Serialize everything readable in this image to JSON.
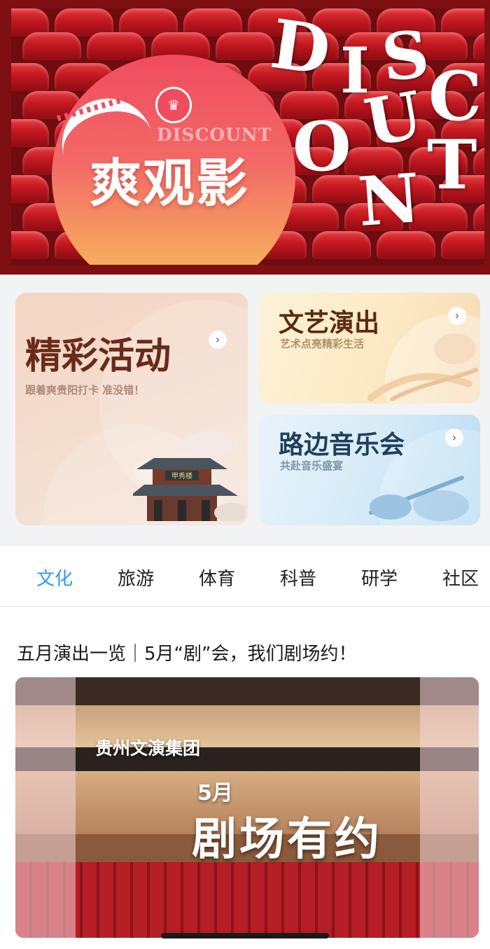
{
  "banner": {
    "title": "爽观影",
    "subtitle_en": "DISCOUNT",
    "big_letters": [
      "D",
      "I",
      "S",
      "C",
      "O",
      "U",
      "N",
      "T"
    ],
    "logo_icon": "theater-logo-icon",
    "colors": {
      "frame": "#7e1014",
      "seat": "#c2181f",
      "sun_top": "#f04c5e",
      "sun_bottom": "#f8c862"
    }
  },
  "cards": {
    "activities": {
      "title": "精彩活动",
      "subtitle": "跟着爽贵阳打卡  准没错！",
      "sign": "甲秀楼"
    },
    "performances": {
      "title": "文艺演出",
      "subtitle": "艺术点亮精彩生活"
    },
    "street_music": {
      "title": "路边音乐会",
      "subtitle": "共赴音乐盛宴"
    }
  },
  "tabs": {
    "items": [
      "文化",
      "旅游",
      "体育",
      "科普",
      "研学",
      "社区"
    ],
    "active_index": 0,
    "active_color": "#2f9be8"
  },
  "article": {
    "title": "五月演出一览｜5月“剧”会，我们剧场约！",
    "image": {
      "org": "贵州文演集团",
      "month": "5月",
      "headline": "剧场有约"
    }
  }
}
